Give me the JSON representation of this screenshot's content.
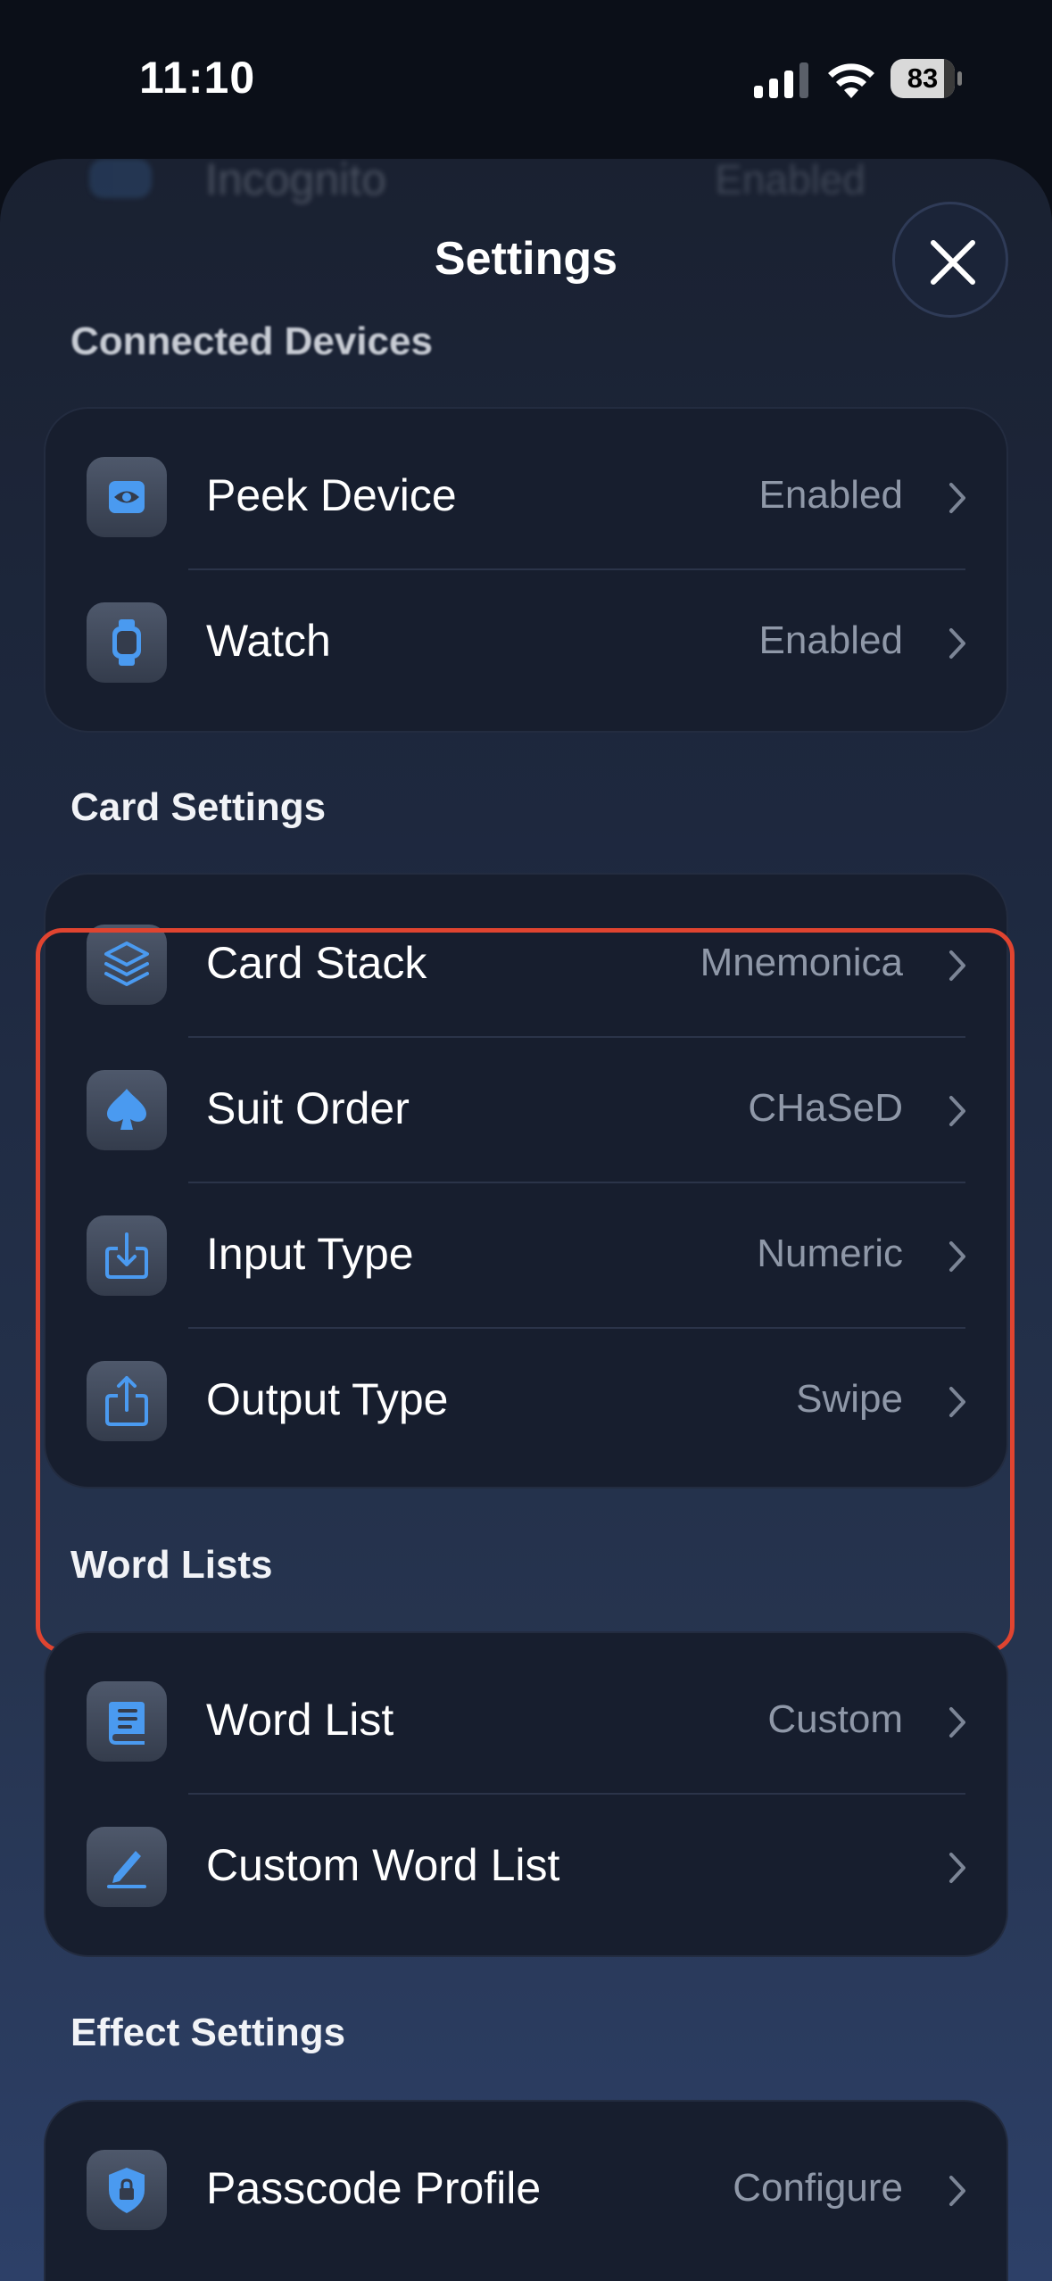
{
  "status_bar": {
    "time": "11:10",
    "battery": "83"
  },
  "sheet": {
    "background_row": {
      "label": "Incognito",
      "value": "Enabled"
    },
    "title": "Settings"
  },
  "sections": {
    "connected_devices": {
      "header": "Connected Devices",
      "rows": [
        {
          "label": "Peek Device",
          "value": "Enabled",
          "icon": "eye-icon"
        },
        {
          "label": "Watch",
          "value": "Enabled",
          "icon": "watch-icon"
        }
      ]
    },
    "card_settings": {
      "header": "Card Settings",
      "rows": [
        {
          "label": "Card Stack",
          "value": "Mnemonica",
          "icon": "stack-layers-icon"
        },
        {
          "label": "Suit Order",
          "value": "CHaSeD",
          "icon": "spade-icon"
        },
        {
          "label": "Input Type",
          "value": "Numeric",
          "icon": "download-icon"
        },
        {
          "label": "Output Type",
          "value": "Swipe",
          "icon": "share-icon"
        }
      ]
    },
    "word_lists": {
      "header": "Word Lists",
      "rows": [
        {
          "label": "Word List",
          "value": "Custom",
          "icon": "book-icon"
        },
        {
          "label": "Custom Word List",
          "value": "",
          "icon": "pencil-icon"
        }
      ]
    },
    "effect_settings": {
      "header": "Effect Settings",
      "rows": [
        {
          "label": "Passcode Profile",
          "value": "Configure",
          "icon": "lock-shield-icon"
        }
      ]
    }
  },
  "colors": {
    "accent_icon": "#4a9af0",
    "highlight_border": "#e04430",
    "value_text": "#8f98a8"
  }
}
